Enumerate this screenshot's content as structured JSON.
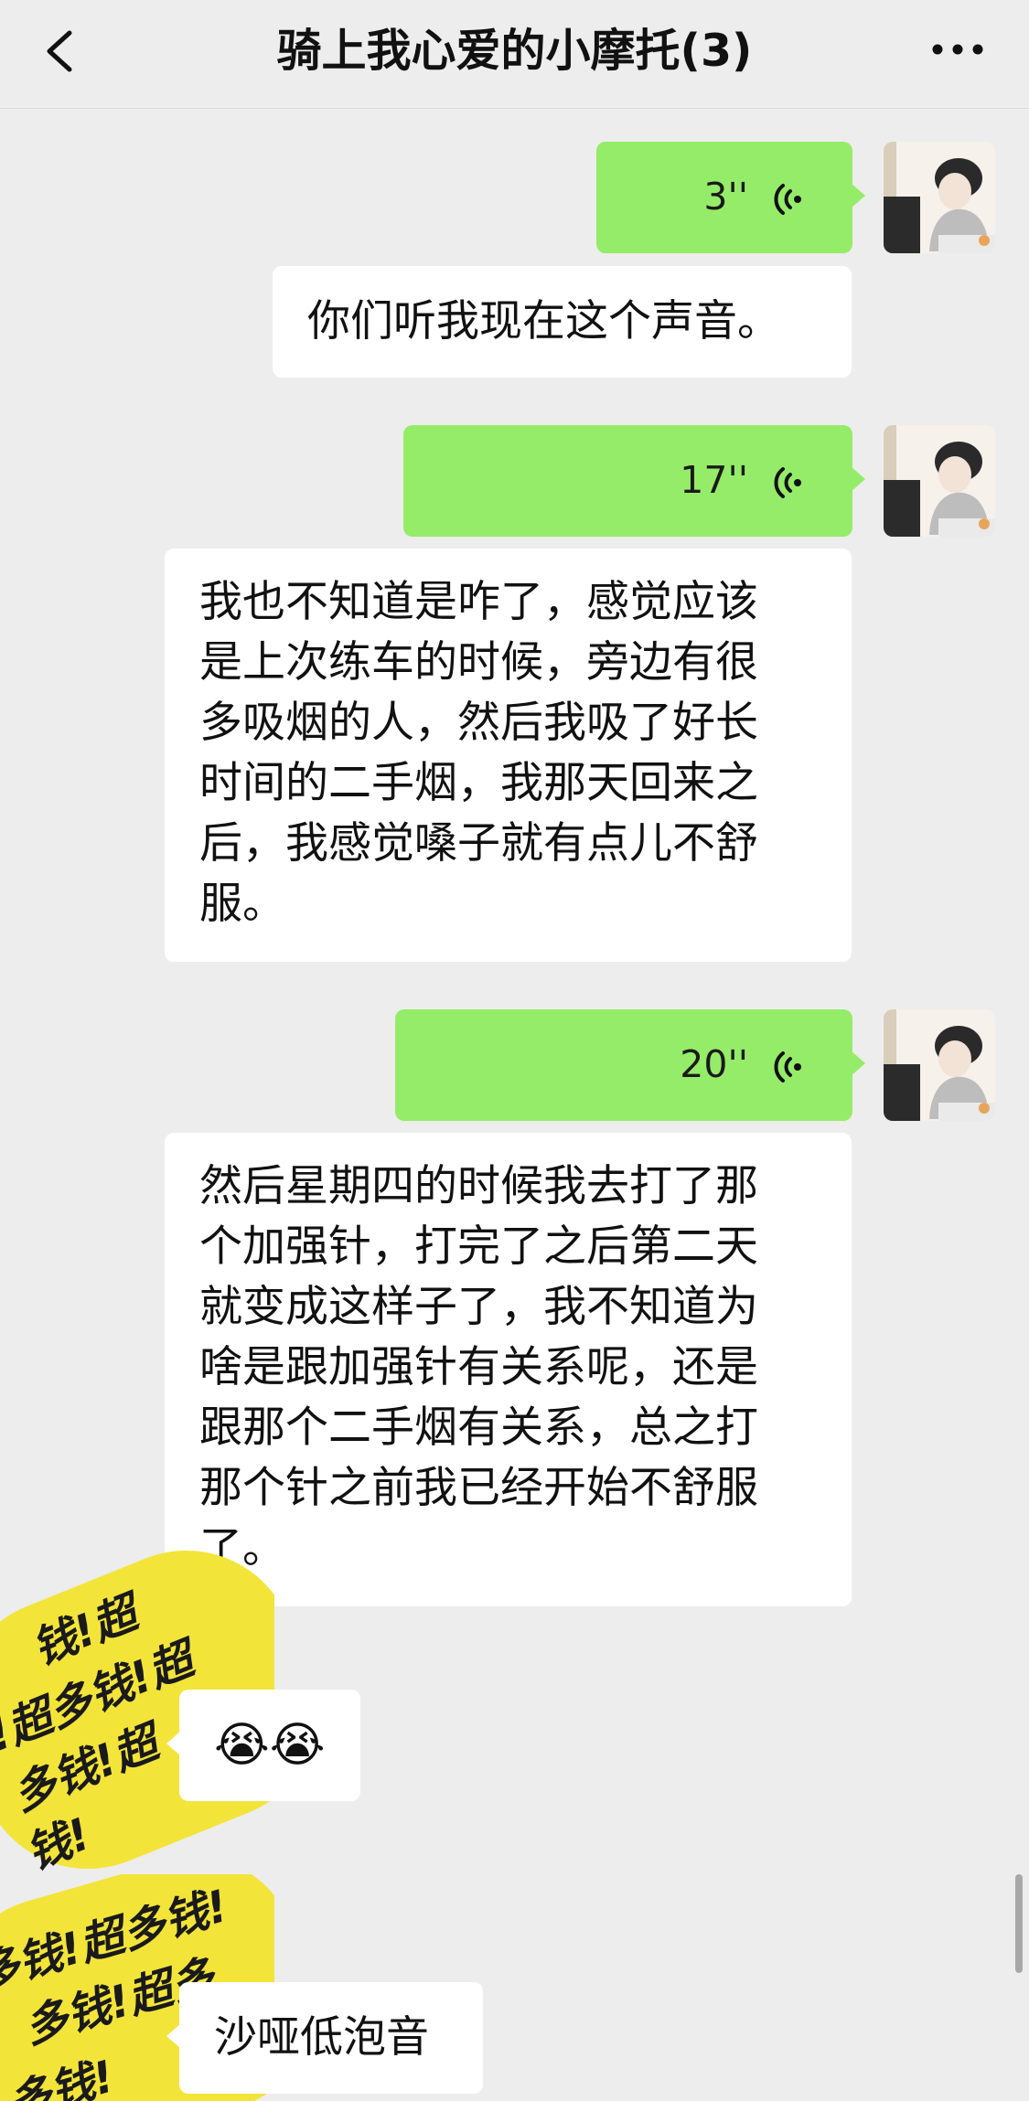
{
  "header": {
    "title": "骑上我心爱的小摩托(3)"
  },
  "messages": {
    "m1": {
      "duration": "3''"
    },
    "m2": {
      "text": "你们听我现在这个声音。"
    },
    "m3": {
      "duration": "17''"
    },
    "m4": {
      "lines": [
        "我也不知道是咋了，感觉应该",
        "是上次练车的时候，旁边有很",
        "多吸烟的人，然后我吸了好长",
        "时间的二手烟，我那天回来之",
        "后，我感觉嗓子就有点儿不舒",
        "服。"
      ]
    },
    "m5": {
      "duration": "20''"
    },
    "m6": {
      "lines": [
        "然后星期四的时候我去打了那",
        "个加强针，打完了之后第二天",
        "就变成这样子了，我不知道为",
        "啥是跟加强针有关系呢，还是",
        "跟那个二手烟有关系，总之打",
        "那个针之前我已经开始不舒服",
        "了。"
      ]
    },
    "m7": {
      "text": "😭😭"
    },
    "m8": {
      "text": "沙哑低泡音"
    }
  },
  "stickers": {
    "s1": {
      "lines": [
        "钱!超",
        "!超多钱!超",
        "多钱!超",
        "钱!"
      ]
    },
    "s2": {
      "lines": [
        "多钱!超多钱!",
        "多钱!超多",
        "多钱!"
      ]
    }
  },
  "colors": {
    "background": "#ededed",
    "sent_bubble": "#95ec69",
    "received_bubble": "#ffffff",
    "sticker_yellow": "#f3e43a"
  }
}
